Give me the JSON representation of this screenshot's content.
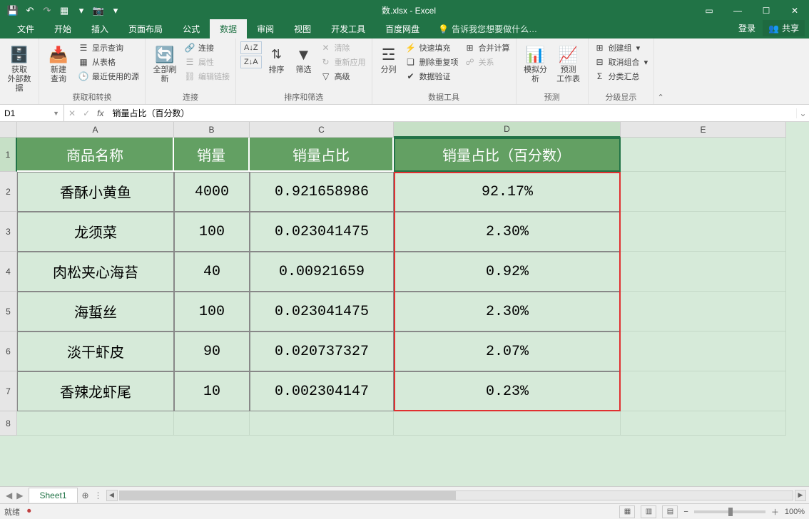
{
  "window": {
    "title": "数.xlsx - Excel"
  },
  "qat": {
    "save": "💾",
    "undo": "↶",
    "redo": "↷",
    "new": "▦",
    "dd": "▾",
    "camera": "📷",
    "dd2": "▾"
  },
  "win": {
    "ribbon_opts": "▭",
    "min": "—",
    "max": "☐",
    "close": "✕"
  },
  "tabs": {
    "file": "文件",
    "home": "开始",
    "insert": "插入",
    "layout": "页面布局",
    "formulas": "公式",
    "data": "数据",
    "review": "审阅",
    "view": "视图",
    "dev": "开发工具",
    "baidu": "百度网盘",
    "tell": "告诉我您想要做什么…",
    "login": "登录",
    "share": "共享"
  },
  "ribbon": {
    "getdata": {
      "big": "获取\n外部数据",
      "group": ""
    },
    "newquery": {
      "big": "新建\n查询",
      "show": "显示查询",
      "table": "从表格",
      "recent": "最近使用的源",
      "group": "获取和转换"
    },
    "refresh": {
      "big": "全部刷新",
      "conn": "连接",
      "prop": "属性",
      "edit": "编辑链接",
      "group": "连接"
    },
    "sort": {
      "az": "A↓Z",
      "za": "Z↓A",
      "sortlbl": "排序",
      "filter": "筛选",
      "clear": "清除",
      "reapply": "重新应用",
      "adv": "高级",
      "group": "排序和筛选"
    },
    "split": {
      "big": "分列",
      "flash": "快速填充",
      "dup": "删除重复项",
      "valid": "数据验证",
      "consol": "合并计算",
      "rel": "关系",
      "group": "数据工具"
    },
    "whatif": {
      "big": "模拟分析",
      "forecast": "预测\n工作表",
      "group": "预测"
    },
    "outline": {
      "create": "创建组",
      "ungroup": "取消组合",
      "subtotal": "分类汇总",
      "group": "分级显示"
    }
  },
  "formula": {
    "namebox": "D1",
    "cancel": "✕",
    "enter": "✓",
    "fx": "fx",
    "value": "销量占比（百分数）"
  },
  "colheads": [
    "A",
    "B",
    "C",
    "D",
    "E"
  ],
  "rowheads": [
    "1",
    "2",
    "3",
    "4",
    "5",
    "6",
    "7",
    "8"
  ],
  "table": {
    "headers": {
      "A": "商品名称",
      "B": "销量",
      "C": "销量占比",
      "D": "销量占比（百分数）"
    },
    "rows": [
      {
        "A": "香酥小黄鱼",
        "B": "4000",
        "C": "0.921658986",
        "D": "92.17%"
      },
      {
        "A": "龙须菜",
        "B": "100",
        "C": "0.023041475",
        "D": "2.30%"
      },
      {
        "A": "肉松夹心海苔",
        "B": "40",
        "C": "0.00921659",
        "D": "0.92%"
      },
      {
        "A": "海蜇丝",
        "B": "100",
        "C": "0.023041475",
        "D": "2.30%"
      },
      {
        "A": "淡干虾皮",
        "B": "90",
        "C": "0.020737327",
        "D": "2.07%"
      },
      {
        "A": "香辣龙虾尾",
        "B": "10",
        "C": "0.002304147",
        "D": "0.23%"
      }
    ]
  },
  "sheet": {
    "name": "Sheet1",
    "add": "⊕"
  },
  "status": {
    "ready": "就绪",
    "rec": "⏺",
    "zoom": "100%",
    "minus": "−",
    "plus": "＋"
  }
}
